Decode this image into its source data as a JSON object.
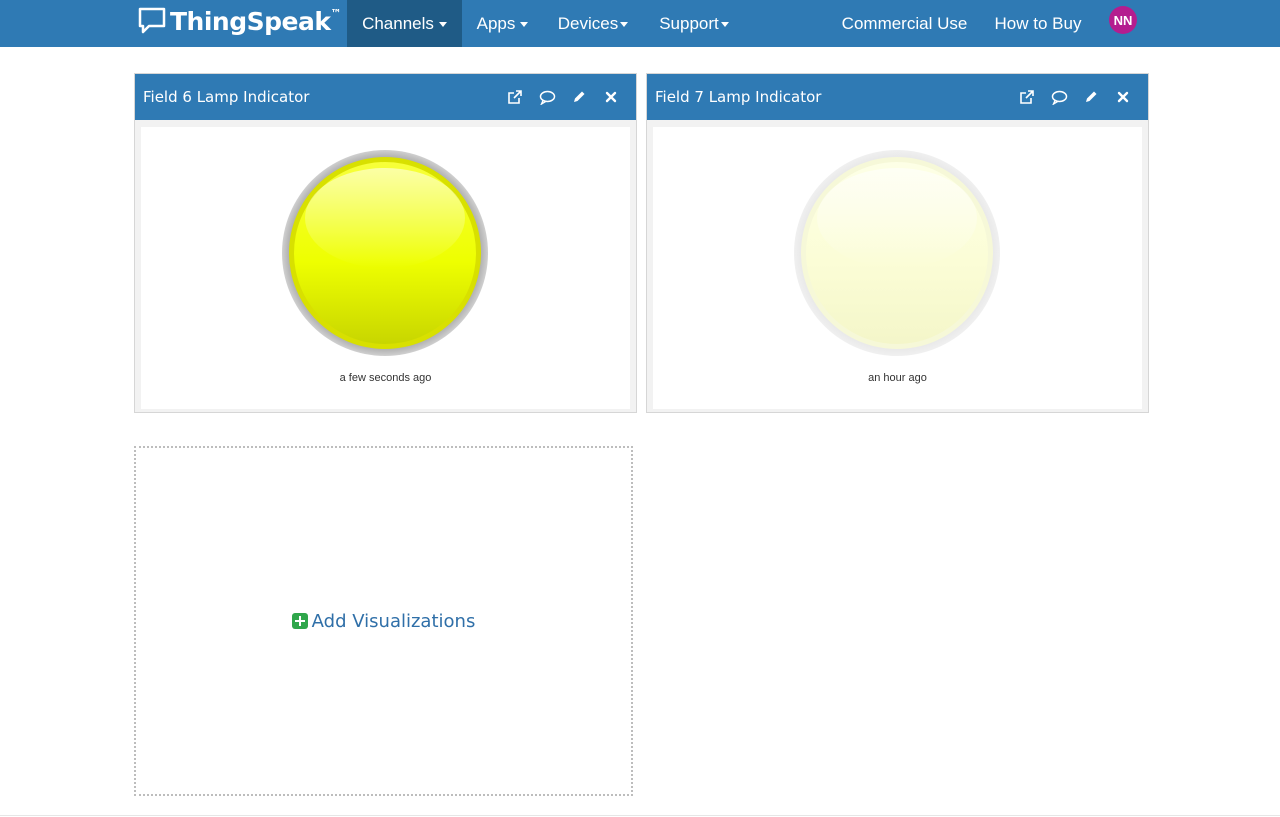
{
  "navbar": {
    "brand": "ThingSpeak",
    "brand_tm": "™",
    "items": [
      {
        "label": "Channels",
        "dropdown": true,
        "active": true
      },
      {
        "label": "Apps",
        "dropdown": true,
        "active": false
      },
      {
        "label": "Devices",
        "dropdown": true,
        "active": false
      },
      {
        "label": "Support",
        "dropdown": true,
        "active": false
      }
    ],
    "right_items": [
      {
        "label": "Commercial Use"
      },
      {
        "label": "How to Buy"
      }
    ],
    "avatar_initials": "NN",
    "colors": {
      "bar": "#2f7ab4",
      "active": "#1f5b86",
      "avatar": "#b41d8f"
    }
  },
  "panels": [
    {
      "title": "Field 6 Lamp Indicator",
      "icons": [
        "external-link-icon",
        "comment-icon",
        "pencil-icon",
        "close-icon"
      ],
      "lamp_state": "on",
      "lamp_color": "#f2f200",
      "timestamp": "a few seconds ago"
    },
    {
      "title": "Field 7 Lamp Indicator",
      "icons": [
        "external-link-icon",
        "comment-icon",
        "pencil-icon",
        "close-icon"
      ],
      "lamp_state": "off",
      "lamp_color": "#fafad2",
      "timestamp": "an hour ago"
    }
  ],
  "add_visualizations": {
    "label": "Add Visualizations",
    "icon": "plus-square-icon",
    "icon_color": "#2fa64b"
  }
}
